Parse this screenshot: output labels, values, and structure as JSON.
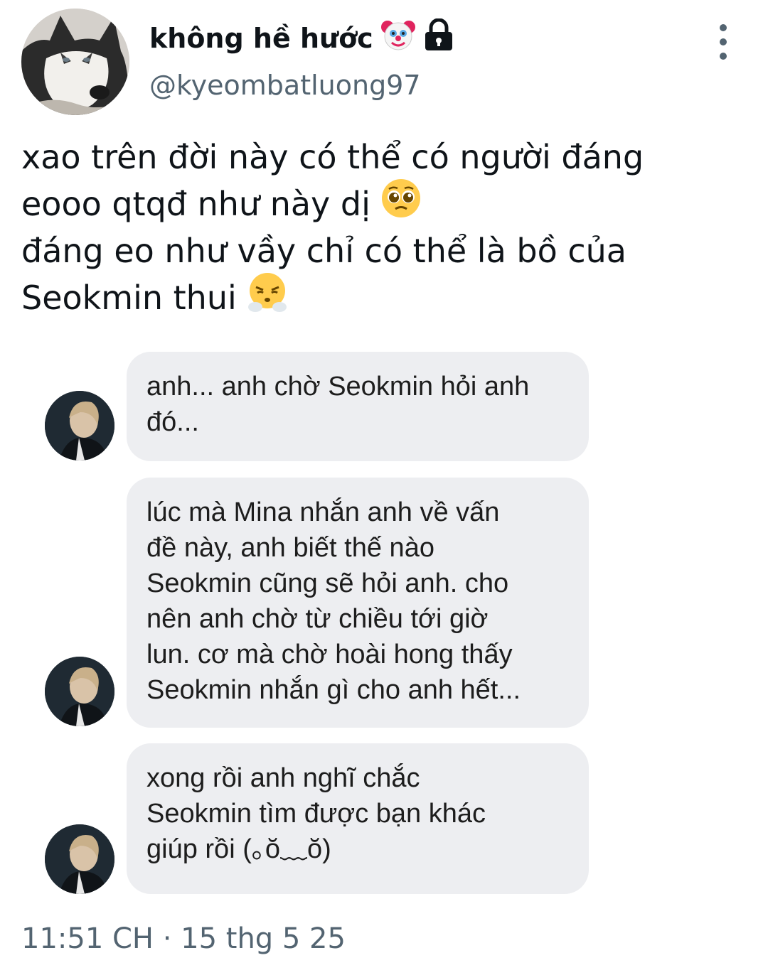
{
  "tweet": {
    "display_name": "không hề hước",
    "name_icons": [
      "clown-face-icon",
      "lock-icon"
    ],
    "handle": "@kyeombatluong97",
    "text_lines": [
      "xao trên đời này có thể có người đáng",
      "eooo qtqđ như này dị",
      "đáng eo như vầy chỉ có thể là bồ của",
      "Seokmin thui"
    ],
    "timestamp": "11:51 CH · 15 thg 5 25"
  },
  "chat": {
    "messages": [
      {
        "lines": [
          "anh... anh chờ Seokmin hỏi anh",
          "đó..."
        ]
      },
      {
        "lines": [
          "lúc mà Mina nhắn anh về vấn",
          "đề này, anh biết thế nào",
          "Seokmin cũng sẽ hỏi anh. cho",
          "nên anh chờ từ chiều tới giờ",
          "lun. cơ mà chờ hoài hong thấy",
          "Seokmin nhắn gì cho anh hết..."
        ]
      },
      {
        "lines": [
          "xong rồi anh nghĩ chắc",
          "Seokmin tìm được bạn khác",
          "giúp rồi (｡ŏ﹏ŏ)"
        ]
      }
    ]
  },
  "colors": {
    "text": "#0f1419",
    "secondary": "#536471",
    "bubble": "#edeef1"
  }
}
